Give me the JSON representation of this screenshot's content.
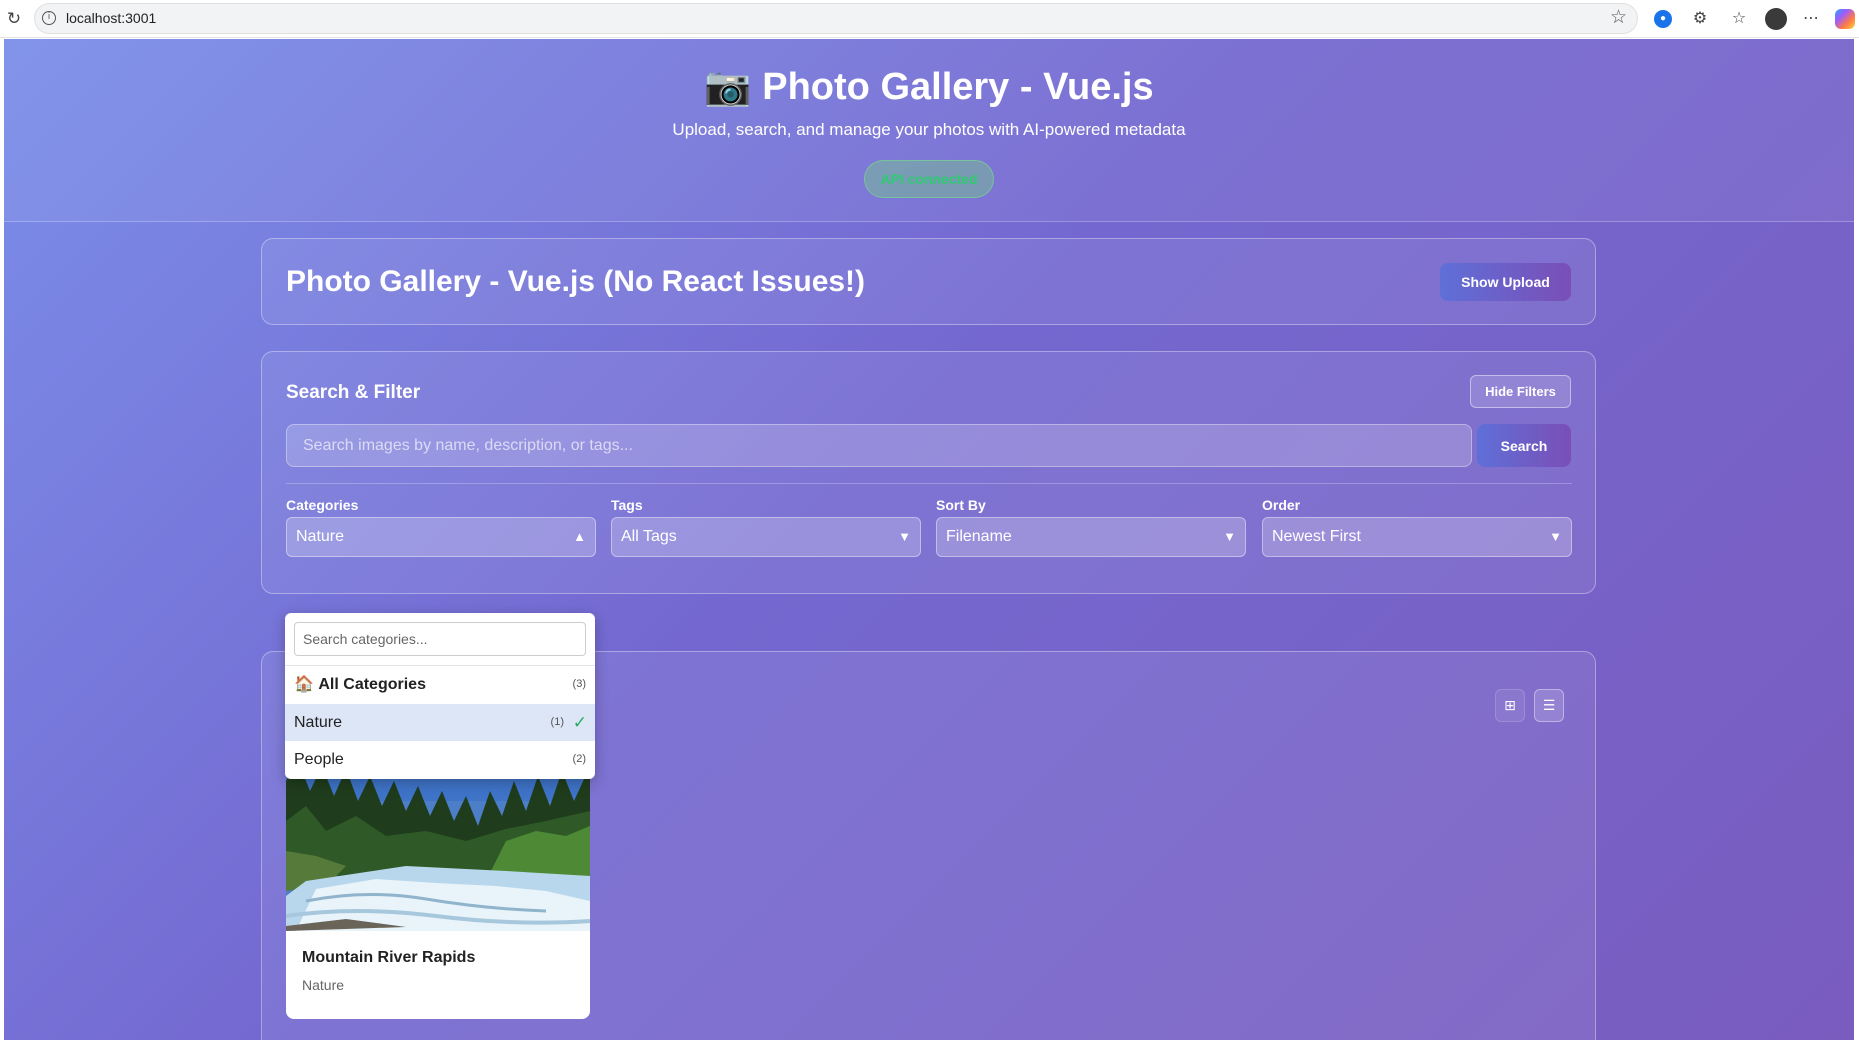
{
  "browser": {
    "url": "localhost:3001"
  },
  "hero": {
    "title": "📷 Photo Gallery - Vue.js",
    "subtitle": "Upload, search, and manage your photos with AI-powered metadata",
    "status": "API connected"
  },
  "gallery_header": {
    "title": "Photo Gallery - Vue.js (No React Issues!)",
    "upload_button": "Show Upload"
  },
  "search_filter": {
    "title": "Search & Filter",
    "hide_button": "Hide Filters",
    "search_placeholder": "Search images by name, description, or tags...",
    "search_button": "Search",
    "filters": [
      {
        "label": "Categories",
        "value": "Nature",
        "arrow": "▲"
      },
      {
        "label": "Tags",
        "value": "All Tags",
        "arrow": "▼"
      },
      {
        "label": "Sort By",
        "value": "Filename",
        "arrow": "▼"
      },
      {
        "label": "Order",
        "value": "Newest First",
        "arrow": "▼"
      }
    ]
  },
  "category_dropdown": {
    "search_placeholder": "Search categories...",
    "items": [
      {
        "icon": "🏠",
        "label": "All Categories",
        "count": "(3)",
        "selected": false
      },
      {
        "label": "Nature",
        "count": "(1)",
        "check": "✓",
        "selected": true
      },
      {
        "label": "People",
        "count": "(2)",
        "selected": false
      }
    ]
  },
  "view_toggle": {
    "grid_icon": "⊞",
    "list_icon": "☰"
  },
  "photos": [
    {
      "title": "Mountain River Rapids",
      "category": "Nature"
    }
  ],
  "colors": {
    "accent_gradient_start": "#5f6fd8",
    "accent_gradient_end": "#7a4fb6",
    "success": "#27ae60",
    "selected_bg": "#dde6f7"
  }
}
